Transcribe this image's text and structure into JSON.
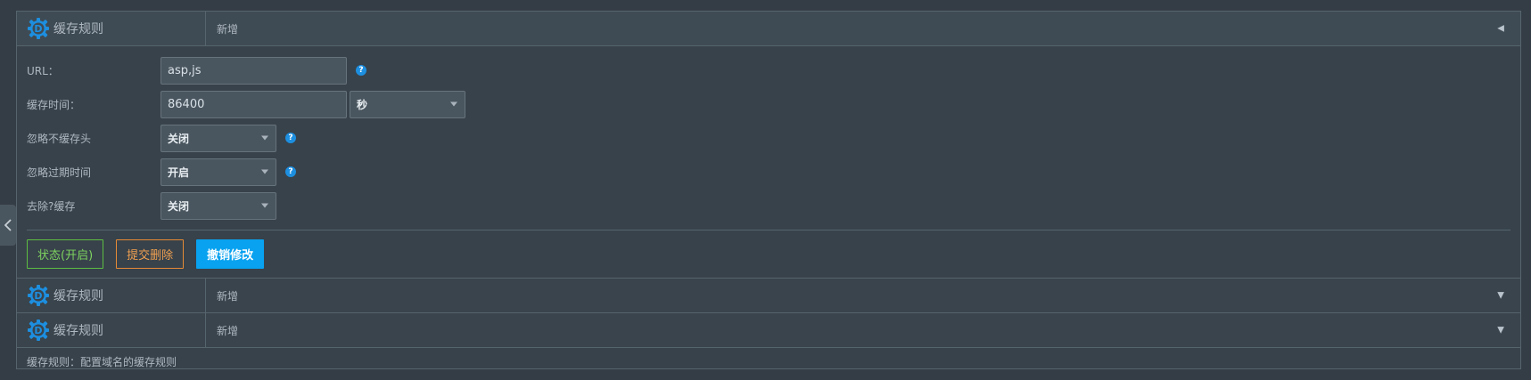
{
  "rules": [
    {
      "title": "缓存规则",
      "subtitle": "新增",
      "expanded": true
    },
    {
      "title": "缓存规则",
      "subtitle": "新增",
      "expanded": false
    },
    {
      "title": "缓存规则",
      "subtitle": "新增",
      "expanded": false
    }
  ],
  "form": {
    "url": {
      "label": "URL：",
      "value": "asp,js"
    },
    "cache_time": {
      "label": "缓存时间：",
      "value": "86400",
      "unit": "秒"
    },
    "ignore_no_cache_header": {
      "label": "忽略不缓存头",
      "value": "关闭"
    },
    "ignore_expire_time": {
      "label": "忽略过期时间",
      "value": "开启"
    },
    "remove_query_cache": {
      "label": "去除?缓存",
      "value": "关闭"
    }
  },
  "actions": {
    "status": "状态(开启)",
    "delete": "提交删除",
    "revert": "撤销修改"
  },
  "footer": {
    "text": "缓存规则：配置域名的缓存规则"
  },
  "icons": {
    "gear": "gear-d-icon",
    "help": "question-icon",
    "collapse": "chevron-left-icon"
  },
  "colors": {
    "accent": "#08a2f0",
    "status_green": "#7dd35f",
    "delete_orange": "#f0a050",
    "gear_blue": "#1d8fe0"
  }
}
